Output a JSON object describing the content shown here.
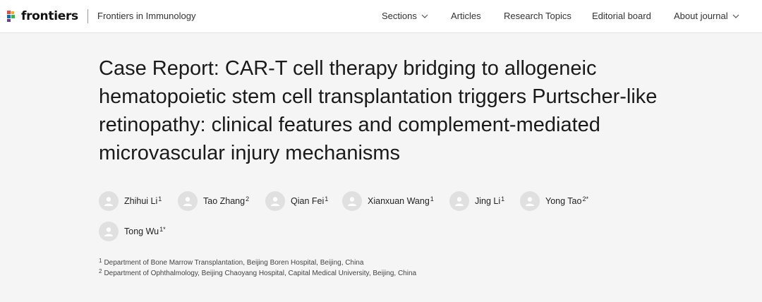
{
  "header": {
    "logo_text": "frontiers",
    "journal": "Frontiers in Immunology",
    "nav": [
      "Sections",
      "Articles",
      "Research Topics",
      "Editorial board",
      "About journal"
    ]
  },
  "article": {
    "title": "Case Report: CAR-T cell therapy bridging to allogeneic hematopoietic stem cell transplantation triggers Purtscher-like retinopathy: clinical features and complement-mediated microvascular injury mechanisms",
    "authors": [
      {
        "name": "Zhihui Li",
        "aff": "1"
      },
      {
        "name": "Tao Zhang",
        "aff": "2"
      },
      {
        "name": "Qian Fei",
        "aff": "1"
      },
      {
        "name": "Xianxuan Wang",
        "aff": "1"
      },
      {
        "name": "Jing Li",
        "aff": "1"
      },
      {
        "name": "Yong Tao",
        "aff": "2*"
      },
      {
        "name": "Tong Wu",
        "aff": "1*"
      }
    ],
    "affiliations": [
      {
        "num": "1",
        "text": "Department of Bone Marrow Transplantation, Beijing Boren Hospital, Beijing, China"
      },
      {
        "num": "2",
        "text": "Department of Ophthalmology, Beijing Chaoyang Hospital, Capital Medical University, Beijing, China"
      }
    ]
  }
}
